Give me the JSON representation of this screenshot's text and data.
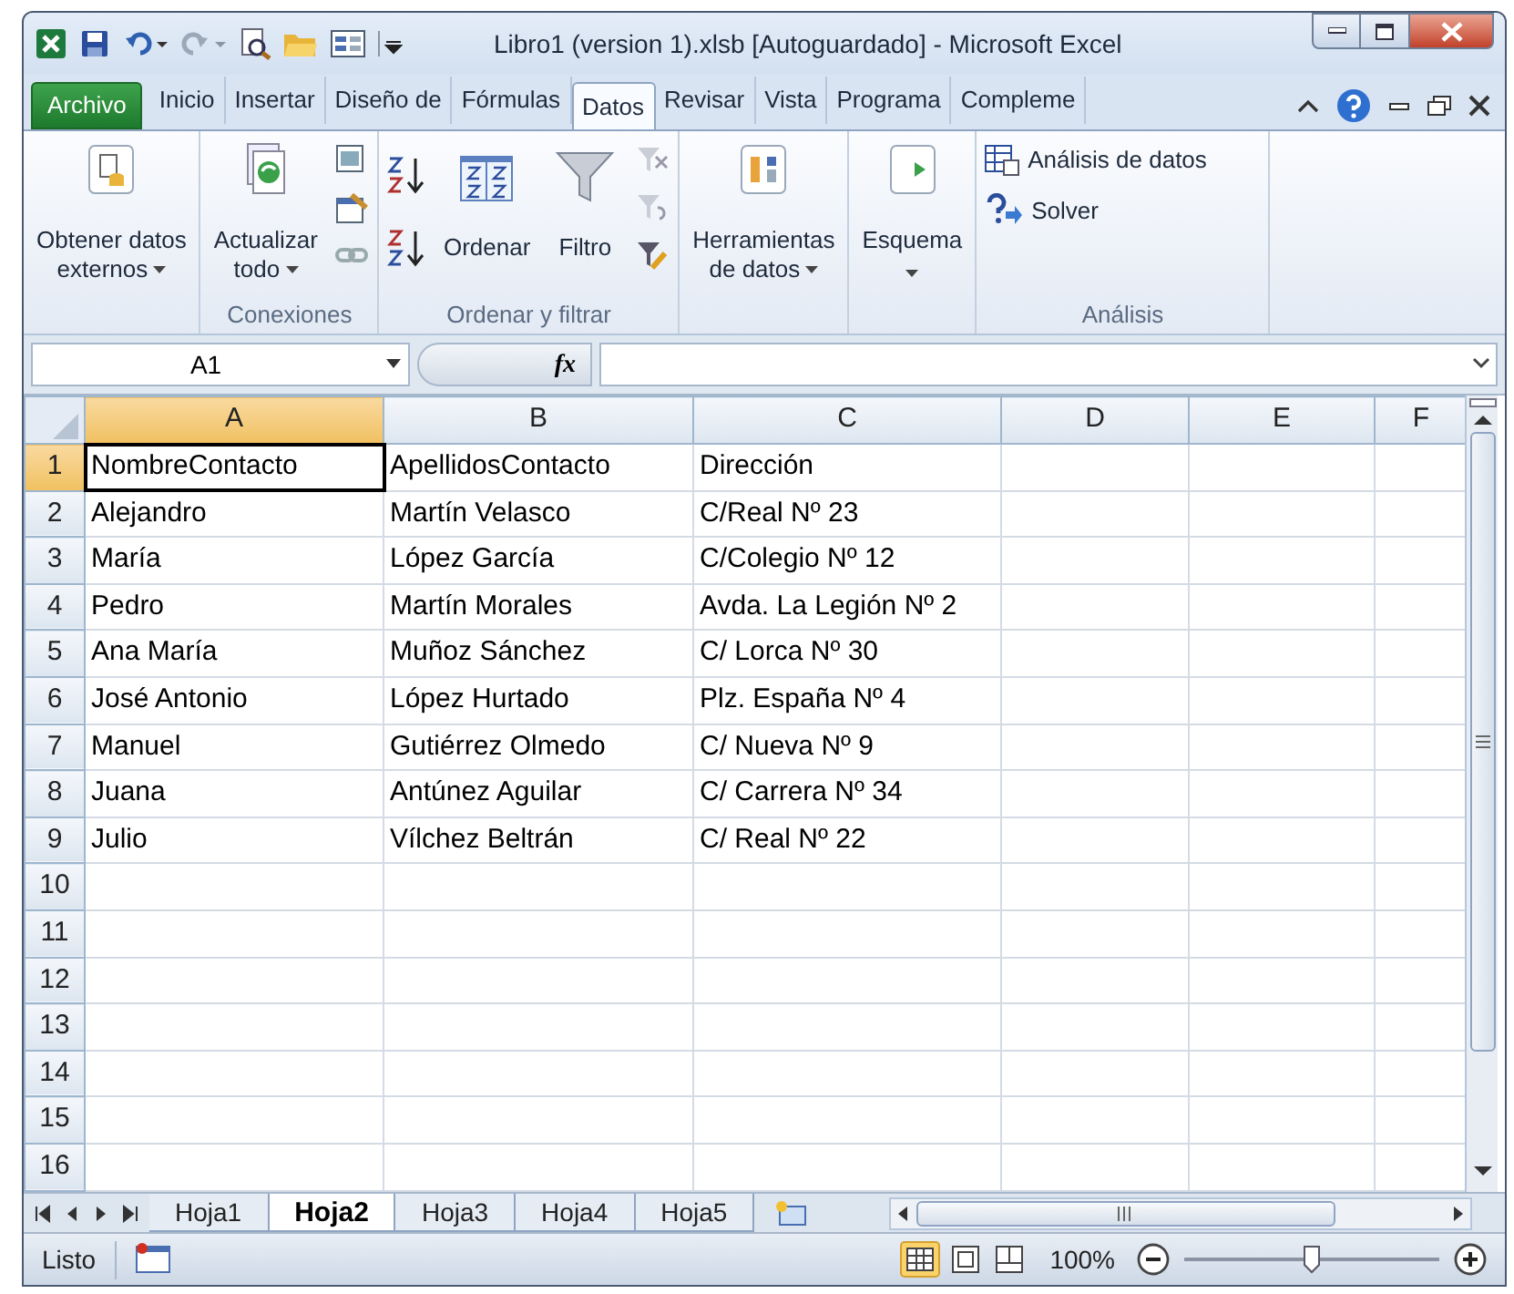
{
  "window": {
    "title": "Libro1 (version 1).xlsb [Autoguardado]  -  Microsoft Excel"
  },
  "ribbon_tabs": [
    {
      "label": "Archivo",
      "kind": "file"
    },
    {
      "label": "Inicio",
      "kind": "tab",
      "selected": false
    },
    {
      "label": "Insertar",
      "kind": "tab",
      "selected": false
    },
    {
      "label": "Diseño de",
      "kind": "tab",
      "selected": false
    },
    {
      "label": "Fórmulas",
      "kind": "tab",
      "selected": false
    },
    {
      "label": "Datos",
      "kind": "tab",
      "selected": true
    },
    {
      "label": "Revisar",
      "kind": "tab",
      "selected": false
    },
    {
      "label": "Vista",
      "kind": "tab",
      "selected": false
    },
    {
      "label": "Programa",
      "kind": "tab",
      "selected": false
    },
    {
      "label": "Compleme",
      "kind": "tab",
      "selected": false
    }
  ],
  "ribbon_groups": [
    {
      "items": [
        {
          "kind": "large",
          "lines": [
            "Obtener datos",
            "externos"
          ],
          "dropdown": true
        }
      ]
    },
    {
      "label": "Conexiones",
      "items": [
        {
          "kind": "large",
          "lines": [
            "Actualizar",
            "todo"
          ],
          "dropdown": true
        },
        {
          "kind": "iconcol"
        }
      ]
    },
    {
      "label": "Ordenar y filtrar",
      "items": [
        {
          "kind": "sortcol"
        },
        {
          "kind": "large",
          "lines": [
            "Ordenar"
          ],
          "dropdown": false
        },
        {
          "kind": "large",
          "lines": [
            "Filtro"
          ],
          "dropdown": false
        },
        {
          "kind": "iconcol"
        }
      ]
    },
    {
      "items": [
        {
          "kind": "large",
          "lines": [
            "Herramientas",
            "de datos"
          ],
          "dropdown": true
        }
      ]
    },
    {
      "items": [
        {
          "kind": "large",
          "lines": [
            "Esquema"
          ],
          "dropdown": true
        }
      ]
    },
    {
      "label": "Análisis",
      "items": [
        {
          "kind": "small",
          "label": "Análisis de datos"
        },
        {
          "kind": "small",
          "label": "Solver"
        }
      ]
    }
  ],
  "formula_bar": {
    "name_box": "A1",
    "function_label": "fx"
  },
  "columns": [
    {
      "label": "A",
      "selected": true
    },
    {
      "label": "B",
      "selected": false
    },
    {
      "label": "C",
      "selected": false
    },
    {
      "label": "D",
      "selected": false
    },
    {
      "label": "E",
      "selected": false
    },
    {
      "label": "F",
      "selected": false
    }
  ],
  "rows": [
    {
      "number": "1",
      "selected": true,
      "cells": [
        "NombreContacto",
        "ApellidosContacto",
        "Dirección"
      ]
    },
    {
      "number": "2",
      "selected": false,
      "cells": [
        "Alejandro",
        "Martín Velasco",
        "C/Real Nº 23"
      ]
    },
    {
      "number": "3",
      "selected": false,
      "cells": [
        "María",
        "López García",
        "C/Colegio Nº 12"
      ]
    },
    {
      "number": "4",
      "selected": false,
      "cells": [
        "Pedro",
        "Martín Morales",
        "Avda. La Legión Nº 2"
      ]
    },
    {
      "number": "5",
      "selected": false,
      "cells": [
        "Ana María",
        "Muñoz Sánchez",
        "C/ Lorca Nº 30"
      ]
    },
    {
      "number": "6",
      "selected": false,
      "cells": [
        "José Antonio",
        "López Hurtado",
        "Plz. España Nº 4"
      ]
    },
    {
      "number": "7",
      "selected": false,
      "cells": [
        "Manuel",
        "Gutiérrez Olmedo",
        "C/ Nueva Nº 9"
      ]
    },
    {
      "number": "8",
      "selected": false,
      "cells": [
        "Juana",
        "Antúnez Aguilar",
        "C/ Carrera Nº 34"
      ]
    },
    {
      "number": "9",
      "selected": false,
      "cells": [
        "Julio",
        "Vílchez Beltrán",
        "C/ Real Nº 22"
      ]
    },
    {
      "number": "10",
      "selected": false
    },
    {
      "number": "11",
      "selected": false
    },
    {
      "number": "12",
      "selected": false
    },
    {
      "number": "13",
      "selected": false
    },
    {
      "number": "14",
      "selected": false
    },
    {
      "number": "15",
      "selected": false
    },
    {
      "number": "16",
      "selected": false
    }
  ],
  "sheet_tabs": [
    {
      "label": "Hoja1",
      "selected": false
    },
    {
      "label": "Hoja2",
      "selected": true
    },
    {
      "label": "Hoja3",
      "selected": false
    },
    {
      "label": "Hoja4",
      "selected": false
    },
    {
      "label": "Hoja5",
      "selected": false
    }
  ],
  "status_bar": {
    "status": "Listo",
    "zoom": "100%",
    "zoom_level": {
      "level": 0.5
    }
  }
}
